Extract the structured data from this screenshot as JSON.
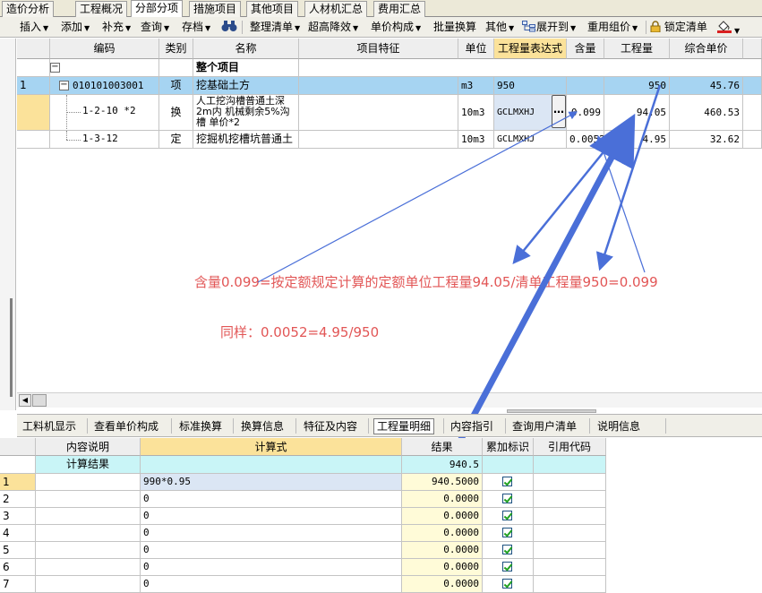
{
  "top_tabs": [
    "造价分析",
    "工程概况",
    "分部分项",
    "措施项目",
    "其他项目",
    "人材机汇总",
    "费用汇总"
  ],
  "toolbar": {
    "insert": "插入",
    "add": "添加",
    "supplement": "补充",
    "query": "查询",
    "save": "存档",
    "arrange": "整理清单",
    "super_down": "超高降效",
    "unit_price": "单价构成",
    "batch": "批量换算",
    "other": "其他",
    "expand": "展开到",
    "reuse": "重用组价",
    "lock": "锁定清单"
  },
  "grid": {
    "headers": {
      "code": "编码",
      "type": "类别",
      "name": "名称",
      "feature": "项目特征",
      "unit": "单位",
      "expr": "工程量表达式",
      "content": "含量",
      "quantity": "工程量",
      "unit_price": "综合单价"
    },
    "group_row": {
      "name": "整个项目"
    },
    "item_row": {
      "num": "1",
      "code": "010101003001",
      "type": "项",
      "name": "挖基础土方",
      "unit": "m3",
      "expr": "950",
      "quantity": "950",
      "unit_price": "45.76"
    },
    "sub_rows": [
      {
        "code": "1-2-10 *2",
        "type": "换",
        "name_lines": [
          "人工挖沟槽普通土深",
          "2m内  机械剩余5%沟",
          "槽 单价*2"
        ],
        "unit": "10m3",
        "expr": "GCLMXHJ",
        "content": "0.099",
        "quantity": "94.05",
        "unit_price": "460.53"
      },
      {
        "code": "1-3-12",
        "type": "定",
        "name": "挖掘机挖槽坑普通土",
        "unit": "10m3",
        "expr": "GCLMXHJ",
        "content": "0.0052",
        "quantity": "4.95",
        "unit_price": "32.62"
      }
    ]
  },
  "annotations": {
    "line1": "含量0.099=按定额规定计算的定额单位工程量94.05/清单工程量950=0.099",
    "line2": "同样：0.0052=4.95/950"
  },
  "lower_tabs": [
    "工料机显示",
    "查看单价构成",
    "标准换算",
    "换算信息",
    "特征及内容",
    "工程量明细",
    "内容指引",
    "查询用户清单",
    "说明信息"
  ],
  "detail": {
    "headers": {
      "desc": "内容说明",
      "formula": "计算式",
      "result": "结果",
      "accum": "累加标识",
      "ref": "引用代码"
    },
    "summary": {
      "desc": "计算结果",
      "result": "940.5"
    },
    "rows": [
      {
        "num": "1",
        "formula": "990*0.95",
        "result": "940.5000",
        "checked": true
      },
      {
        "num": "2",
        "formula": "0",
        "result": "0.0000",
        "checked": true
      },
      {
        "num": "3",
        "formula": "0",
        "result": "0.0000",
        "checked": true
      },
      {
        "num": "4",
        "formula": "0",
        "result": "0.0000",
        "checked": true
      },
      {
        "num": "5",
        "formula": "0",
        "result": "0.0000",
        "checked": true
      },
      {
        "num": "6",
        "formula": "0",
        "result": "0.0000",
        "checked": true
      },
      {
        "num": "7",
        "formula": "0",
        "result": "0.0000",
        "checked": true
      }
    ]
  },
  "colors": {
    "header_highlight": "#fbe29a",
    "selected_row": "#a6d4f2",
    "annotation_text": "#e25656",
    "arrow": "#4a6fd8"
  }
}
